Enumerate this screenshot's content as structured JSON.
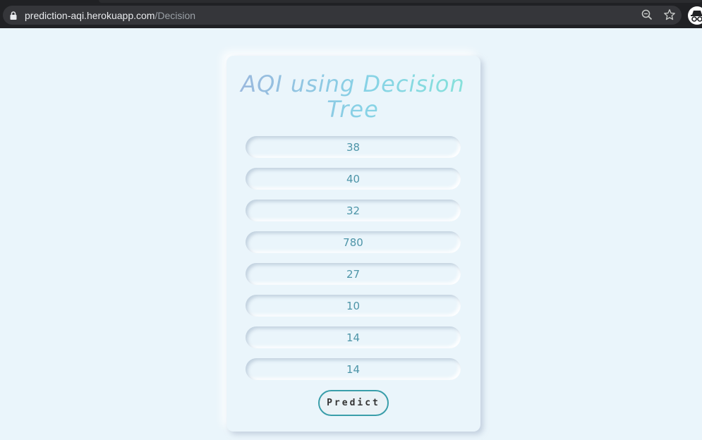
{
  "browser": {
    "url_host": "prediction-aqi.herokuapp.com",
    "url_path": "/Decision"
  },
  "form": {
    "title": "AQI using Decision Tree",
    "fields": [
      "38",
      "40",
      "32",
      "780",
      "27",
      "10",
      "14",
      "14"
    ],
    "submit_label": "Predict"
  },
  "icons": {
    "lock": "lock-icon",
    "zoom": "zoom-out-icon",
    "bookmark": "star-icon",
    "profile": "incognito-icon"
  }
}
